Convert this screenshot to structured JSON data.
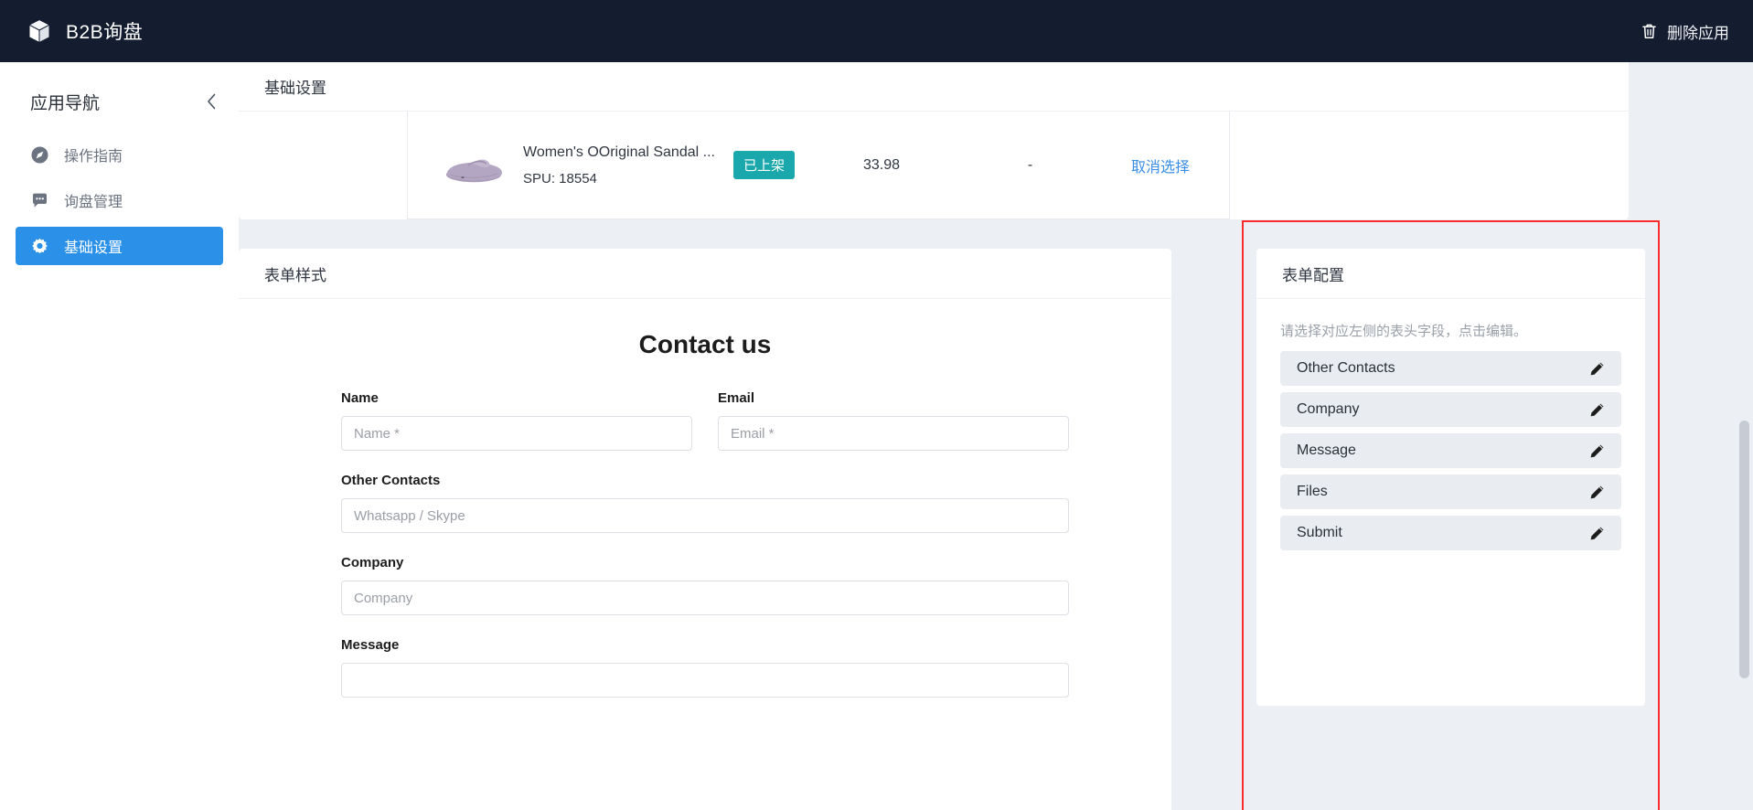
{
  "topbar": {
    "brand_icon": "cube-icon",
    "brand_title": "B2B询盘",
    "delete_icon": "trash-icon",
    "delete_label": "删除应用"
  },
  "sidebar": {
    "title": "应用导航",
    "collapse_icon": "chevron-left-icon",
    "items": [
      {
        "label": "操作指南",
        "icon": "compass-icon",
        "active": false
      },
      {
        "label": "询盘管理",
        "icon": "chat-bubble-icon",
        "active": false
      },
      {
        "label": "基础设置",
        "icon": "gear-icon",
        "active": true
      }
    ]
  },
  "settings_card": {
    "title": "基础设置",
    "product": {
      "image_alt": "sandal-product-image",
      "title": "Women's OOriginal Sandal ...",
      "spu": "SPU: 18554",
      "status_badge": "已上架",
      "price": "33.98",
      "dash": "-",
      "cancel_link": "取消选择"
    }
  },
  "form_style": {
    "title": "表单样式",
    "heading": "Contact us",
    "fields": [
      {
        "label": "Name",
        "placeholder": "Name *"
      },
      {
        "label": "Email",
        "placeholder": "Email *"
      },
      {
        "label": "Other Contacts",
        "placeholder": "Whatsapp / Skype"
      },
      {
        "label": "Company",
        "placeholder": "Company"
      },
      {
        "label": "Message",
        "placeholder": ""
      }
    ]
  },
  "form_config": {
    "title": "表单配置",
    "hint": "请选择对应左侧的表头字段，点击编辑。",
    "items": [
      {
        "label": "Other Contacts",
        "edit_icon": "pencil-icon"
      },
      {
        "label": "Company",
        "edit_icon": "pencil-icon"
      },
      {
        "label": "Message",
        "edit_icon": "pencil-icon"
      },
      {
        "label": "Files",
        "edit_icon": "pencil-icon"
      },
      {
        "label": "Submit",
        "edit_icon": "pencil-icon"
      }
    ],
    "highlight_color": "#fb2c2c"
  },
  "colors": {
    "topbar_bg": "#141c30",
    "accent_blue": "#2a90e8",
    "badge_teal": "#1aa8ac",
    "link_blue": "#3a8ee6",
    "page_bg": "#eceff3"
  }
}
